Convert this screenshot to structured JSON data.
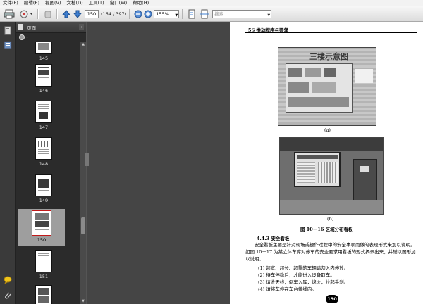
{
  "menu": [
    "文件(F)",
    "编辑(E)",
    "视图(V)",
    "文档(D)",
    "工具(T)",
    "窗口(W)",
    "帮助(H)"
  ],
  "toolbar": {
    "page_value": "150",
    "page_count": "(164 / 397)",
    "zoom_value": "155%",
    "search_placeholder": "搜索"
  },
  "panel": {
    "title": "页面",
    "collapse": "◂"
  },
  "thumbnails": [
    {
      "label": "145"
    },
    {
      "label": "146"
    },
    {
      "label": "147"
    },
    {
      "label": "148"
    },
    {
      "label": "149"
    },
    {
      "label": "150",
      "selected": true
    },
    {
      "label": "151"
    }
  ],
  "document": {
    "running_head": "5S 推动程序与要领",
    "photo_a_text": "三楼示意图",
    "caption_a": "(a)",
    "caption_b": "(b)",
    "figure_caption": "图 10－16   区域分布看板",
    "section_title": "4.4.3   安全看板",
    "paragraph": "安全看板主要是针对现场或操作过程中的安全事项而做的表现形式来加以说明。如图 10－17 为某立体车库对停车的安全要求用看板的形式揭示出来，并辅以图形加以说明：",
    "items": [
      "(1) 超宽、超长、超重的车辆请勿入内停放。",
      "(2) 待车停稳后，才能进入设备取车。",
      "(3) 请收天线，倒车入库，熄火，拉起手刹。",
      "(4) 请将车停在车台黄线内。"
    ],
    "page_number": "150"
  },
  "colors": {
    "selected_border": "#c21a1a",
    "panel_bg": "#2b2b2b",
    "doc_bg": "#454545"
  }
}
